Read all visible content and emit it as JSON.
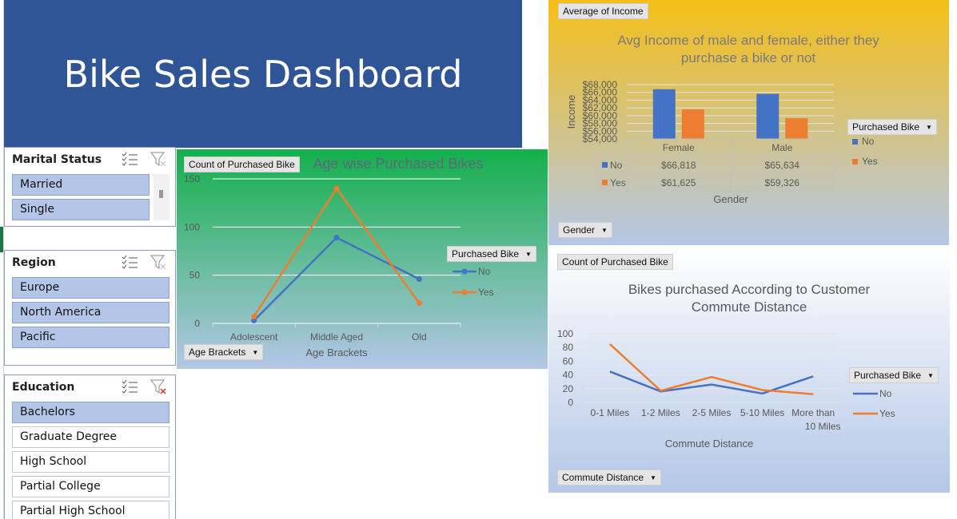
{
  "dashboard": {
    "title": "Bike Sales Dashboard"
  },
  "slicers": {
    "marital": {
      "title": "Marital Status",
      "items": [
        "Married",
        "Single"
      ]
    },
    "region": {
      "title": "Region",
      "items": [
        "Europe",
        "North America",
        "Pacific"
      ]
    },
    "education": {
      "title": "Education",
      "items": [
        "Bachelors",
        "Graduate Degree",
        "High School",
        "Partial College",
        "Partial High School"
      ]
    }
  },
  "icons": {
    "multiselect": "multi-select-icon",
    "clear_filter": "clear-filter-icon"
  },
  "colors": {
    "no": "#4472c4",
    "yes": "#ed7d31",
    "banner": "#2f5597"
  },
  "chart_age": {
    "field_value": "Count of Purchased Bike",
    "field_axis": "Age Brackets",
    "legend_title": "Purchased Bike"
  },
  "chart_income": {
    "field_value": "Average of Income",
    "field_axis": "Gender",
    "legend_title": "Purchased Bike",
    "table_no": [
      "$66,818",
      "$65,634"
    ],
    "table_yes": [
      "$61,625",
      "$59,326"
    ]
  },
  "chart_commute": {
    "field_value": "Count of Purchased Bike",
    "field_axis": "Commute Distance",
    "legend_title": "Purchased Bike"
  },
  "chart_data": [
    {
      "type": "line",
      "title": "Age wise Purchased Bikes",
      "xlabel": "Age Brackets",
      "ylabel": "",
      "categories": [
        "Adolescent",
        "Middle Aged",
        "Old"
      ],
      "series": [
        {
          "name": "No",
          "values": [
            3,
            89,
            46
          ]
        },
        {
          "name": "Yes",
          "values": [
            7,
            140,
            21
          ]
        }
      ],
      "ylim": [
        0,
        150
      ],
      "yticks": [
        "0",
        "50",
        "100",
        "150"
      ],
      "grid": true,
      "legend": "right"
    },
    {
      "type": "bar",
      "title": "Avg Income of male and female, either they purchase a bike or not",
      "xlabel": "Gender",
      "ylabel": "Income",
      "categories": [
        "Female",
        "Male"
      ],
      "series": [
        {
          "name": "No",
          "values": [
            66818,
            65634
          ]
        },
        {
          "name": "Yes",
          "values": [
            61625,
            59326
          ]
        }
      ],
      "ylim": [
        54000,
        68000
      ],
      "yticks": [
        "$54,000",
        "$56,000",
        "$58,000",
        "$60,000",
        "$62,000",
        "$64,000",
        "$66,000",
        "$68,000"
      ],
      "grid": true,
      "legend": "right"
    },
    {
      "type": "line",
      "title": "Bikes purchased According  to Customer Commute Distance",
      "xlabel": "Commute Distance",
      "ylabel": "",
      "categories": [
        "0-1 Miles",
        "1-2 Miles",
        "2-5 Miles",
        "5-10 Miles",
        "More than 10 Miles"
      ],
      "series": [
        {
          "name": "No",
          "values": [
            45,
            16,
            26,
            13,
            38
          ]
        },
        {
          "name": "Yes",
          "values": [
            85,
            17,
            37,
            18,
            12
          ]
        }
      ],
      "ylim": [
        0,
        100
      ],
      "yticks": [
        "0",
        "20",
        "40",
        "60",
        "80",
        "100"
      ],
      "grid": true,
      "legend": "right"
    }
  ]
}
